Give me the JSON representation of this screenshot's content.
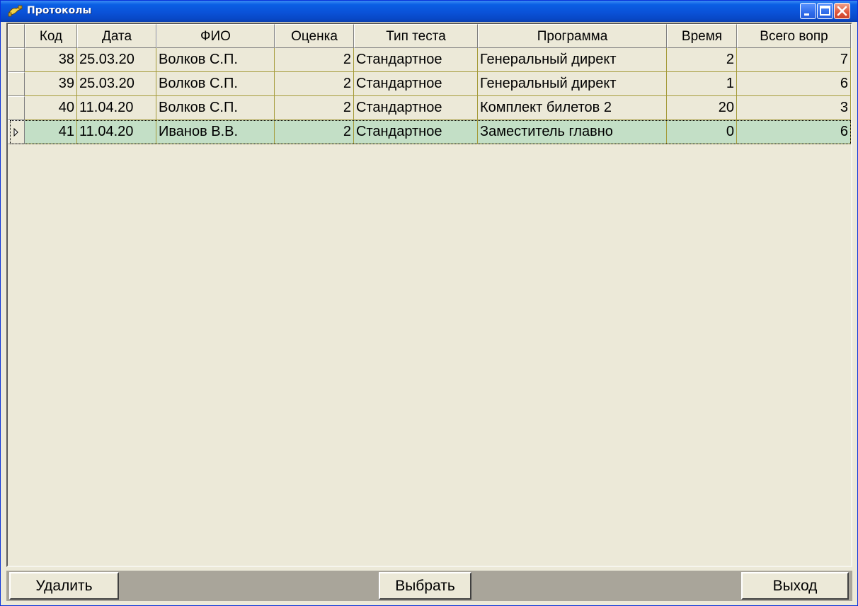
{
  "window": {
    "title": "Протоколы",
    "icon": "app-cable-icon",
    "controls": [
      "minimize-icon",
      "maximize-icon",
      "close-icon"
    ]
  },
  "grid": {
    "columns": [
      "Код",
      "Дата",
      "ФИО",
      "Оценка",
      "Тип теста",
      "Программа",
      "Время",
      "Всего вопр"
    ],
    "rows": [
      {
        "code": "38",
        "date": "25.03.20",
        "fio": "Волков С.П.",
        "grade": "2",
        "test_type": "Стандартное",
        "program": "Генеральный директ",
        "time": "2",
        "total": "7"
      },
      {
        "code": "39",
        "date": "25.03.20",
        "fio": "Волков С.П.",
        "grade": "2",
        "test_type": "Стандартное",
        "program": "Генеральный директ",
        "time": "1",
        "total": "6"
      },
      {
        "code": "40",
        "date": "11.04.20",
        "fio": "Волков С.П.",
        "grade": "2",
        "test_type": "Стандартное",
        "program": "Комплект билетов 2",
        "time": "20",
        "total": "3"
      },
      {
        "code": "41",
        "date": "11.04.20",
        "fio": "Иванов В.В.",
        "grade": "2",
        "test_type": "Стандартное",
        "program": "Заместитель главно",
        "time": "0",
        "total": "6"
      }
    ],
    "selected_row_index": 3,
    "row_pointer_icon": "row-pointer-icon"
  },
  "buttons": {
    "delete": "Удалить",
    "select": "Выбрать",
    "exit": "Выход"
  },
  "colors": {
    "title_bar": "#0a52d8",
    "selected_row": "#c3dfc6",
    "grid_line": "#a59b3a"
  }
}
